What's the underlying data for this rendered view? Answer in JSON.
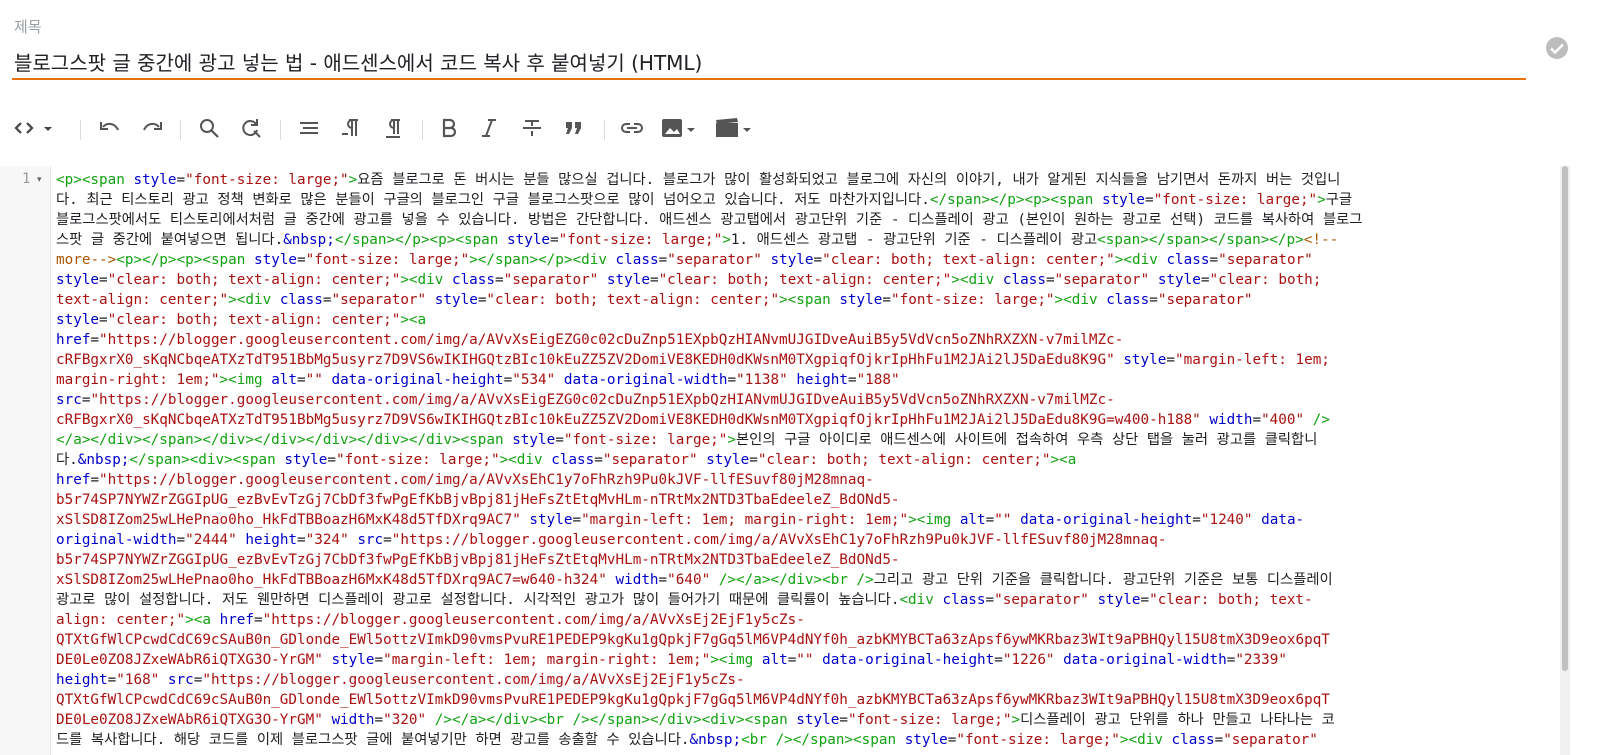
{
  "post": {
    "title_label": "제목",
    "title_value": "블로그스팟 글 중간에 광고 넣는 법 - 애드센스에서 코드 복사 후 붙여넣기 (HTML)"
  },
  "toolbar": {
    "mode_icon": "code-view-icon",
    "items": [
      "undo-icon",
      "redo-icon",
      "search-icon",
      "replace-icon",
      "format-icon",
      "paragraph-icon",
      "paragraph-clean-icon",
      "bold-icon",
      "italic-icon",
      "strikethrough-icon",
      "quote-icon",
      "link-icon",
      "image-icon",
      "video-icon"
    ]
  },
  "editor": {
    "line_number": "1",
    "lines": [
      [
        [
          "t",
          "<p><span "
        ],
        [
          "a",
          "style"
        ],
        [
          "p",
          "="
        ],
        [
          "s",
          "\"font-size: large;\""
        ],
        [
          "t",
          ">"
        ],
        [
          "p",
          "요즘 블로그로 돈 버시는 분들 많으실 겁니다. 블로그가 많이 활성화되었고 블로그에 자신의 이야기, 내가 알게된 지식들을 남기면서 돈까지 버는 것입니"
        ]
      ],
      [
        [
          "p",
          "다. 최근 티스토리 광고 정책 변화로 많은 분들이 구글의 블로그인 구글 블로그스팟으로 많이 넘어오고 있습니다. 저도 마찬가지입니다."
        ],
        [
          "t",
          "</span></p><p><span "
        ],
        [
          "a",
          "style"
        ],
        [
          "p",
          "="
        ],
        [
          "s",
          "\"font-size: large;\""
        ],
        [
          "t",
          ">"
        ],
        [
          "p",
          "구글"
        ]
      ],
      [
        [
          "p",
          "블로그스팟에서도 티스토리에서처럼 글 중간에 광고를 넣을 수 있습니다. 방법은 간단합니다. 애드센스 광고탭에서 광고단위 기준 - 디스플레이 광고 (본인이 원하는 광고로 선택) 코드를 복사하여 블로그"
        ]
      ],
      [
        [
          "p",
          "스팟 글 중간에 붙여넣으면 됩니다."
        ],
        [
          "e",
          "&nbsp;"
        ],
        [
          "t",
          "</span></p><p><span "
        ],
        [
          "a",
          "style"
        ],
        [
          "p",
          "="
        ],
        [
          "s",
          "\"font-size: large;\""
        ],
        [
          "t",
          ">"
        ],
        [
          "p",
          "1. 애드센스 광고탭 - 광고단위 기준 - 디스플레이 광고"
        ],
        [
          "t",
          "<span></span></span></p>"
        ],
        [
          "c",
          "<!--"
        ]
      ],
      [
        [
          "c",
          "more-->"
        ],
        [
          "t",
          "<p></p><p><span "
        ],
        [
          "a",
          "style"
        ],
        [
          "p",
          "="
        ],
        [
          "s",
          "\"font-size: large;\""
        ],
        [
          "t",
          "></span></p><div "
        ],
        [
          "a",
          "class"
        ],
        [
          "p",
          "="
        ],
        [
          "s",
          "\"separator\""
        ],
        [
          "p",
          " "
        ],
        [
          "a",
          "style"
        ],
        [
          "p",
          "="
        ],
        [
          "s",
          "\"clear: both; text-align: center;\""
        ],
        [
          "t",
          "><div "
        ],
        [
          "a",
          "class"
        ],
        [
          "p",
          "="
        ],
        [
          "s",
          "\"separator\""
        ]
      ],
      [
        [
          "a",
          "style"
        ],
        [
          "p",
          "="
        ],
        [
          "s",
          "\"clear: both; text-align: center;\""
        ],
        [
          "t",
          "><div "
        ],
        [
          "a",
          "class"
        ],
        [
          "p",
          "="
        ],
        [
          "s",
          "\"separator\""
        ],
        [
          "p",
          " "
        ],
        [
          "a",
          "style"
        ],
        [
          "p",
          "="
        ],
        [
          "s",
          "\"clear: both; text-align: center;\""
        ],
        [
          "t",
          "><div "
        ],
        [
          "a",
          "class"
        ],
        [
          "p",
          "="
        ],
        [
          "s",
          "\"separator\""
        ],
        [
          "p",
          " "
        ],
        [
          "a",
          "style"
        ],
        [
          "p",
          "="
        ],
        [
          "s",
          "\"clear: both;"
        ]
      ],
      [
        [
          "s",
          "text-align: center;\""
        ],
        [
          "t",
          "><div "
        ],
        [
          "a",
          "class"
        ],
        [
          "p",
          "="
        ],
        [
          "s",
          "\"separator\""
        ],
        [
          "p",
          " "
        ],
        [
          "a",
          "style"
        ],
        [
          "p",
          "="
        ],
        [
          "s",
          "\"clear: both; text-align: center;\""
        ],
        [
          "t",
          "><span "
        ],
        [
          "a",
          "style"
        ],
        [
          "p",
          "="
        ],
        [
          "s",
          "\"font-size: large;\""
        ],
        [
          "t",
          "><div "
        ],
        [
          "a",
          "class"
        ],
        [
          "p",
          "="
        ],
        [
          "s",
          "\"separator\""
        ]
      ],
      [
        [
          "a",
          "style"
        ],
        [
          "p",
          "="
        ],
        [
          "s",
          "\"clear: both; text-align: center;\""
        ],
        [
          "t",
          "><a"
        ]
      ],
      [
        [
          "a",
          "href"
        ],
        [
          "p",
          "="
        ],
        [
          "s",
          "\"https://blogger.googleusercontent.com/img/a/AVvXsEigEZG0c02cDuZnp51EXpbQzHIANvmUJGIDveAuiB5y5VdVcn5oZNhRXZXN-v7milMZc-"
        ]
      ],
      [
        [
          "s",
          "cRFBgxrX0_sKqNCbqeATXzTdT951BbMg5usyrz7D9VS6wIKIHGQtzBIc10kEuZZ5ZV2DomiVE8KEDH0dKWsnM0TXgpiqfOjkrIpHhFu1M2JAi2lJ5DaEdu8K9G\""
        ],
        [
          "p",
          " "
        ],
        [
          "a",
          "style"
        ],
        [
          "p",
          "="
        ],
        [
          "s",
          "\"margin-left: 1em;"
        ]
      ],
      [
        [
          "s",
          "margin-right: 1em;\""
        ],
        [
          "t",
          "><img "
        ],
        [
          "a",
          "alt"
        ],
        [
          "p",
          "="
        ],
        [
          "s",
          "\"\""
        ],
        [
          "p",
          " "
        ],
        [
          "a",
          "data-original-height"
        ],
        [
          "p",
          "="
        ],
        [
          "s",
          "\"534\""
        ],
        [
          "p",
          " "
        ],
        [
          "a",
          "data-original-width"
        ],
        [
          "p",
          "="
        ],
        [
          "s",
          "\"1138\""
        ],
        [
          "p",
          " "
        ],
        [
          "a",
          "height"
        ],
        [
          "p",
          "="
        ],
        [
          "s",
          "\"188\""
        ]
      ],
      [
        [
          "a",
          "src"
        ],
        [
          "p",
          "="
        ],
        [
          "s",
          "\"https://blogger.googleusercontent.com/img/a/AVvXsEigEZG0c02cDuZnp51EXpbQzHIANvmUJGIDveAuiB5y5VdVcn5oZNhRXZXN-v7milMZc-"
        ]
      ],
      [
        [
          "s",
          "cRFBgxrX0_sKqNCbqeATXzTdT951BbMg5usyrz7D9VS6wIKIHGQtzBIc10kEuZZ5ZV2DomiVE8KEDH0dKWsnM0TXgpiqfOjkrIpHhFu1M2JAi2lJ5DaEdu8K9G=w400-h188\""
        ],
        [
          "p",
          " "
        ],
        [
          "a",
          "width"
        ],
        [
          "p",
          "="
        ],
        [
          "s",
          "\"400\""
        ],
        [
          "p",
          " "
        ],
        [
          "t",
          "/>"
        ]
      ],
      [
        [
          "t",
          "</a></div></span></div></div></div></div></div><span "
        ],
        [
          "a",
          "style"
        ],
        [
          "p",
          "="
        ],
        [
          "s",
          "\"font-size: large;\""
        ],
        [
          "t",
          ">"
        ],
        [
          "p",
          "본인의 구글 아이디로 애드센스에 사이트에 접속하여 우측 상단 탭을 눌러 광고를 클릭합니"
        ]
      ],
      [
        [
          "p",
          "다."
        ],
        [
          "e",
          "&nbsp;"
        ],
        [
          "t",
          "</span><div><span "
        ],
        [
          "a",
          "style"
        ],
        [
          "p",
          "="
        ],
        [
          "s",
          "\"font-size: large;\""
        ],
        [
          "t",
          "><div "
        ],
        [
          "a",
          "class"
        ],
        [
          "p",
          "="
        ],
        [
          "s",
          "\"separator\""
        ],
        [
          "p",
          " "
        ],
        [
          "a",
          "style"
        ],
        [
          "p",
          "="
        ],
        [
          "s",
          "\"clear: both; text-align: center;\""
        ],
        [
          "t",
          "><a"
        ]
      ],
      [
        [
          "a",
          "href"
        ],
        [
          "p",
          "="
        ],
        [
          "s",
          "\"https://blogger.googleusercontent.com/img/a/AVvXsEhC1y7oFhRzh9Pu0kJVF-llfESuvf80jM28mnaq-"
        ]
      ],
      [
        [
          "s",
          "b5r74SP7NYWZrZGGIpUG_ezBvEvTzGj7CbDf3fwPgEfKbBjvBpj81jHeFsZtEtqMvHLm-nTRtMx2NTD3TbaEdeeleZ_BdONd5-"
        ]
      ],
      [
        [
          "s",
          "xSlSD8IZom25wLHePnao0ho_HkFdTBBoazH6MxK48d5TfDXrq9AC7\""
        ],
        [
          "p",
          " "
        ],
        [
          "a",
          "style"
        ],
        [
          "p",
          "="
        ],
        [
          "s",
          "\"margin-left: 1em; margin-right: 1em;\""
        ],
        [
          "t",
          "><img "
        ],
        [
          "a",
          "alt"
        ],
        [
          "p",
          "="
        ],
        [
          "s",
          "\"\""
        ],
        [
          "p",
          " "
        ],
        [
          "a",
          "data-original-height"
        ],
        [
          "p",
          "="
        ],
        [
          "s",
          "\"1240\""
        ],
        [
          "p",
          " "
        ],
        [
          "a",
          "data-"
        ]
      ],
      [
        [
          "a",
          "original-width"
        ],
        [
          "p",
          "="
        ],
        [
          "s",
          "\"2444\""
        ],
        [
          "p",
          " "
        ],
        [
          "a",
          "height"
        ],
        [
          "p",
          "="
        ],
        [
          "s",
          "\"324\""
        ],
        [
          "p",
          " "
        ],
        [
          "a",
          "src"
        ],
        [
          "p",
          "="
        ],
        [
          "s",
          "\"https://blogger.googleusercontent.com/img/a/AVvXsEhC1y7oFhRzh9Pu0kJVF-llfESuvf80jM28mnaq-"
        ]
      ],
      [
        [
          "s",
          "b5r74SP7NYWZrZGGIpUG_ezBvEvTzGj7CbDf3fwPgEfKbBjvBpj81jHeFsZtEtqMvHLm-nTRtMx2NTD3TbaEdeeleZ_BdONd5-"
        ]
      ],
      [
        [
          "s",
          "xSlSD8IZom25wLHePnao0ho_HkFdTBBoazH6MxK48d5TfDXrq9AC7=w640-h324\""
        ],
        [
          "p",
          " "
        ],
        [
          "a",
          "width"
        ],
        [
          "p",
          "="
        ],
        [
          "s",
          "\"640\""
        ],
        [
          "p",
          " "
        ],
        [
          "t",
          "/></a></div><br />"
        ],
        [
          "p",
          "그리고 광고 단위 기준을 클릭합니다. 광고단위 기준은 보통 디스플레이"
        ]
      ],
      [
        [
          "p",
          "광고로 많이 설정합니다. 저도 웬만하면 디스플레이 광고로 설정합니다. 시각적인 광고가 많이 들어가기 때문에 클릭률이 높습니다."
        ],
        [
          "t",
          "<div "
        ],
        [
          "a",
          "class"
        ],
        [
          "p",
          "="
        ],
        [
          "s",
          "\"separator\""
        ],
        [
          "p",
          " "
        ],
        [
          "a",
          "style"
        ],
        [
          "p",
          "="
        ],
        [
          "s",
          "\"clear: both; text-"
        ]
      ],
      [
        [
          "s",
          "align: center;\""
        ],
        [
          "t",
          "><a "
        ],
        [
          "a",
          "href"
        ],
        [
          "p",
          "="
        ],
        [
          "s",
          "\"https://blogger.googleusercontent.com/img/a/AVvXsEj2EjF1y5cZs-"
        ]
      ],
      [
        [
          "s",
          "QTXtGfWlCPcwdCdC69cSAuB0n_GDlonde_EWl5ottzVImkD90vmsPvuRE1PEDEP9kgKu1gQpkjF7gGq5lM6VP4dNYf0h_azbKMYBCTa63zApsf6ywMKRbaz3WIt9aPBHQyl15U8tmX3D9eox6pqT"
        ]
      ],
      [
        [
          "s",
          "DE0Le0ZO8JZxeWAbR6iQTXG3O-YrGM\""
        ],
        [
          "p",
          " "
        ],
        [
          "a",
          "style"
        ],
        [
          "p",
          "="
        ],
        [
          "s",
          "\"margin-left: 1em; margin-right: 1em;\""
        ],
        [
          "t",
          "><img "
        ],
        [
          "a",
          "alt"
        ],
        [
          "p",
          "="
        ],
        [
          "s",
          "\"\""
        ],
        [
          "p",
          " "
        ],
        [
          "a",
          "data-original-height"
        ],
        [
          "p",
          "="
        ],
        [
          "s",
          "\"1226\""
        ],
        [
          "p",
          " "
        ],
        [
          "a",
          "data-original-width"
        ],
        [
          "p",
          "="
        ],
        [
          "s",
          "\"2339\""
        ]
      ],
      [
        [
          "a",
          "height"
        ],
        [
          "p",
          "="
        ],
        [
          "s",
          "\"168\""
        ],
        [
          "p",
          " "
        ],
        [
          "a",
          "src"
        ],
        [
          "p",
          "="
        ],
        [
          "s",
          "\"https://blogger.googleusercontent.com/img/a/AVvXsEj2EjF1y5cZs-"
        ]
      ],
      [
        [
          "s",
          "QTXtGfWlCPcwdCdC69cSAuB0n_GDlonde_EWl5ottzVImkD90vmsPvuRE1PEDEP9kgKu1gQpkjF7gGq5lM6VP4dNYf0h_azbKMYBCTa63zApsf6ywMKRbaz3WIt9aPBHQyl15U8tmX3D9eox6pqT"
        ]
      ],
      [
        [
          "s",
          "DE0Le0ZO8JZxeWAbR6iQTXG3O-YrGM\""
        ],
        [
          "p",
          " "
        ],
        [
          "a",
          "width"
        ],
        [
          "p",
          "="
        ],
        [
          "s",
          "\"320\""
        ],
        [
          "p",
          " "
        ],
        [
          "t",
          "/></a></div><br /></span></div><div><span "
        ],
        [
          "a",
          "style"
        ],
        [
          "p",
          "="
        ],
        [
          "s",
          "\"font-size: large;\""
        ],
        [
          "t",
          ">"
        ],
        [
          "p",
          "디스플레이 광고 단위를 하나 만들고 나타나는 코"
        ]
      ],
      [
        [
          "p",
          "드를 복사합니다. 해당 코드를 이제 블로그스팟 글에 붙여넣기만 하면 광고를 송출할 수 있습니다."
        ],
        [
          "e",
          "&nbsp;"
        ],
        [
          "t",
          "<br /></span><span "
        ],
        [
          "a",
          "style"
        ],
        [
          "p",
          "="
        ],
        [
          "s",
          "\"font-size: large;\""
        ],
        [
          "t",
          "><div "
        ],
        [
          "a",
          "class"
        ],
        [
          "p",
          "="
        ],
        [
          "s",
          "\"separator\""
        ]
      ]
    ]
  }
}
